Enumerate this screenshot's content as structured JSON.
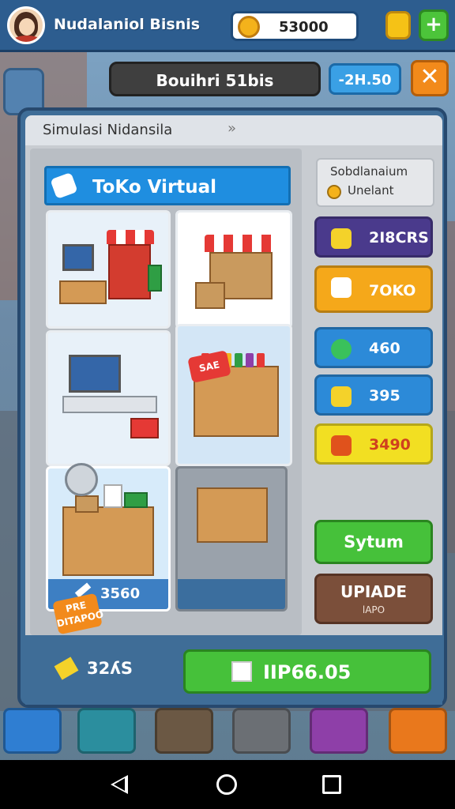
{
  "header": {
    "app_title": "Nudalaniol Bisnis",
    "coins": "53000",
    "plus": "+"
  },
  "subheader": {
    "business_name": "Bouihri 51bis",
    "balance": "-2H.50",
    "close": "✕"
  },
  "panel": {
    "title": "Simulasi Nidansila",
    "chevron": "»"
  },
  "shop": {
    "title": "ToKo Virtual",
    "sale_tag_1": "SAE",
    "sale_tag_2": "PRE DITAPOO",
    "tiles": [
      {
        "name": "market-stall-with-computer"
      },
      {
        "name": "awning-kiosk"
      },
      {
        "name": "computer-workstation"
      },
      {
        "name": "wooden-shelf-goods"
      },
      {
        "name": "stocked-shelf",
        "price": "3560"
      },
      {
        "name": "empty-cart-table",
        "price": ""
      }
    ]
  },
  "side": {
    "info_line1": "Sobdlanaium",
    "info_line2": "Unelant",
    "stats": [
      {
        "label": "2I8CRS",
        "icon": "flag-icon"
      },
      {
        "label": "7OKO",
        "icon": "box-icon"
      },
      {
        "label": "460",
        "icon": "clock-icon"
      },
      {
        "label": "395",
        "icon": "thumb-icon"
      },
      {
        "label": "3490",
        "icon": "flame-icon"
      }
    ],
    "system_button": "Sytum",
    "upgrade_button": "UPIADE",
    "upgrade_sub": "lAPO"
  },
  "footer": {
    "count": "32ʎS",
    "buy_label": "IIP66.05"
  },
  "colors": {
    "primary_blue": "#1f8ee0",
    "green": "#46c13a",
    "orange": "#f28a1b"
  }
}
